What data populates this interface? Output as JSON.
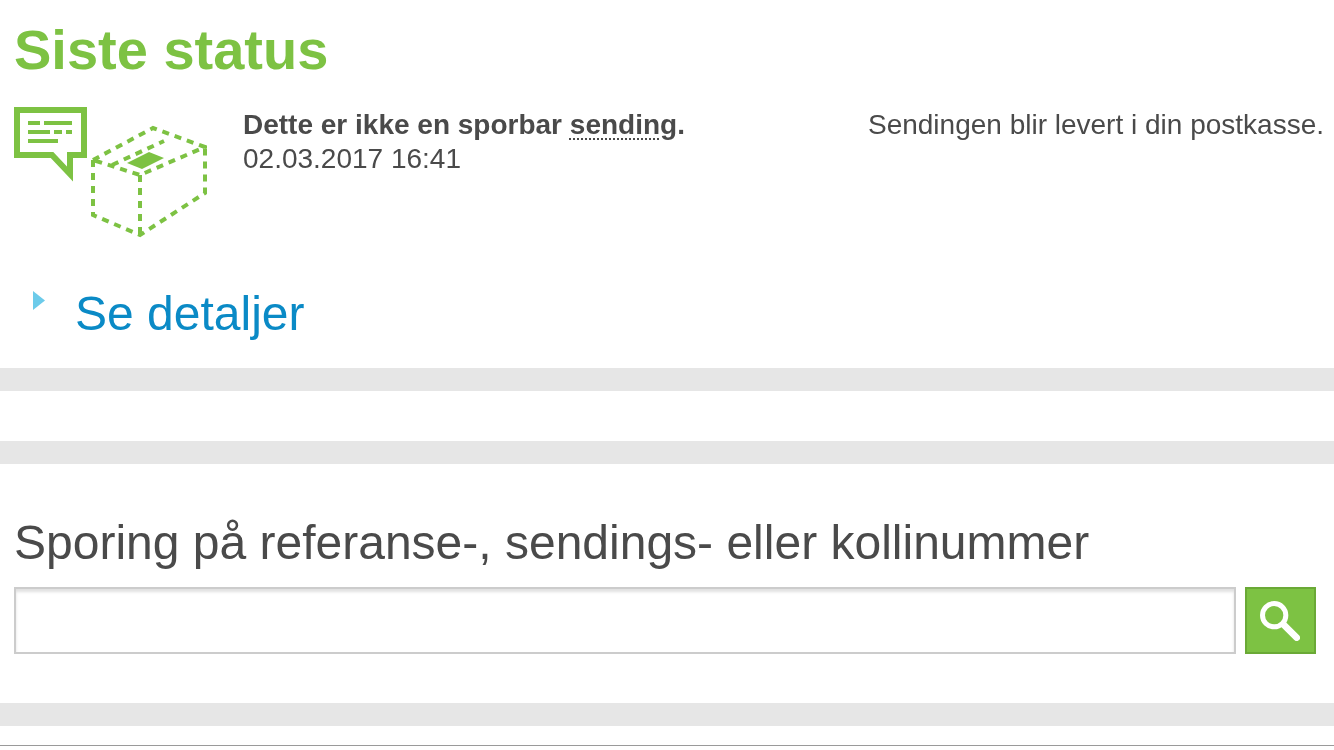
{
  "latest_status": {
    "title": "Siste status",
    "message": [
      {
        "kind": "plain",
        "text": "Dette er ikke en sporbar "
      },
      {
        "kind": "term",
        "text": "sending"
      },
      {
        "kind": "plain",
        "text": "."
      }
    ],
    "timestamp": "02.03.2017 16:41",
    "delivery_note": "Sendingen blir levert i din postkasse.",
    "details_link": {
      "label": "Se detaljer",
      "expanded": false
    }
  },
  "tracking": {
    "label": "Sporing på referanse-, sendings- eller kollinummer"
  }
}
